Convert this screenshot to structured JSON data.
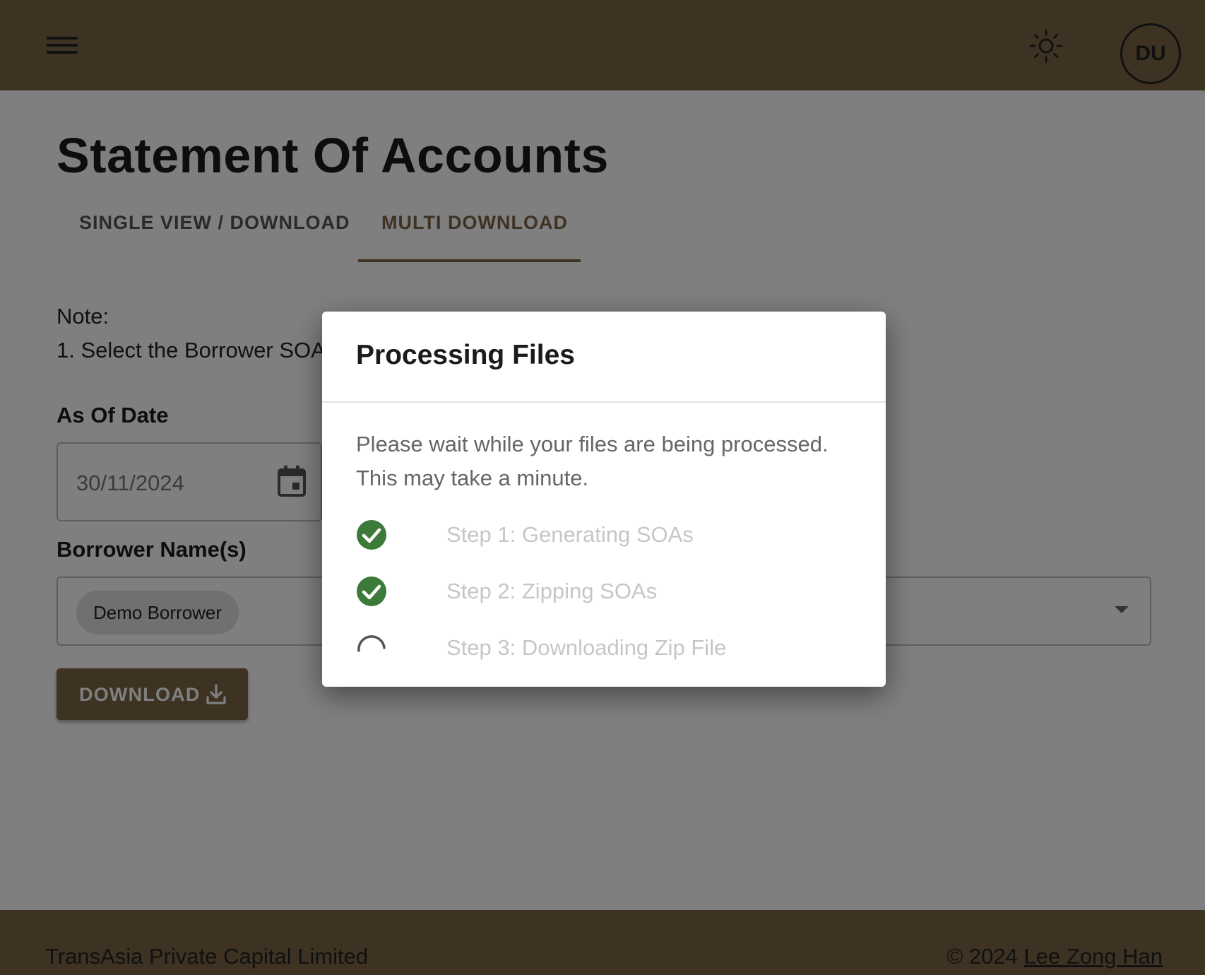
{
  "app": {
    "avatar_initials": "DU",
    "accent_color": "#7d6546"
  },
  "page": {
    "title": "Statement Of Accounts",
    "tabs": [
      {
        "label": "SINGLE VIEW / DOWNLOAD",
        "active": false
      },
      {
        "label": "MULTI DOWNLOAD",
        "active": true
      }
    ],
    "note_heading": "Note:",
    "note_line1": "1. Select the Borrower SOA",
    "as_of_date_label": "As Of Date",
    "as_of_date_value": "30/11/2024",
    "borrower_label": "Borrower Name(s)",
    "borrower_chips": [
      "Demo Borrower"
    ],
    "download_label": "DOWNLOAD"
  },
  "footer": {
    "company": "TransAsia Private Capital Limited",
    "copyright": "© 2024",
    "author_link": "Lee Zong Han"
  },
  "dialog": {
    "title": "Processing Files",
    "message": "Please wait while your files are being processed. This may take a minute.",
    "steps": [
      {
        "label": "Step 1: Generating SOAs",
        "status": "done",
        "icon": "check-circle-icon"
      },
      {
        "label": "Step 2: Zipping SOAs",
        "status": "done",
        "icon": "check-circle-icon"
      },
      {
        "label": "Step 3: Downloading Zip File",
        "status": "in-progress",
        "icon": "spinner-icon"
      }
    ],
    "done_color": "#3c7a3a"
  }
}
